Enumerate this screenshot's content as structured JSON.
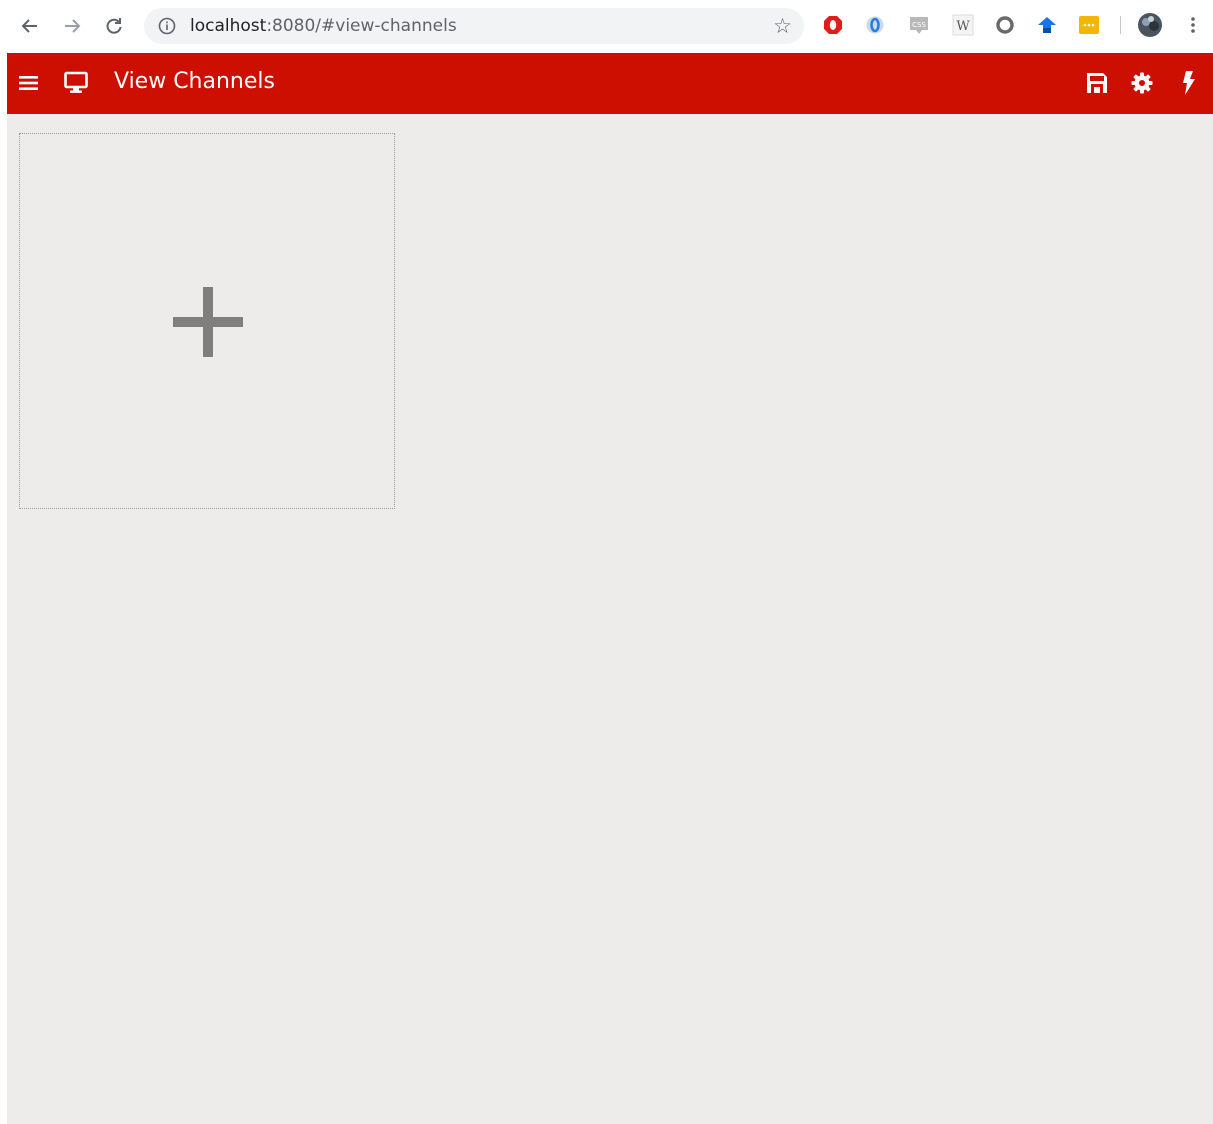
{
  "browser": {
    "url_host": "localhost",
    "url_rest": ":8080/#view-channels",
    "icons": {
      "back": "arrow-left-icon",
      "forward": "arrow-right-icon",
      "reload": "reload-icon",
      "info": "info-icon",
      "bookmark": "star-icon"
    },
    "extensions": [
      {
        "name": "adblock-extension-icon",
        "color": "#e21b1b"
      },
      {
        "name": "opera-extension-icon",
        "color": "#2a7fd4"
      },
      {
        "name": "css-extension-icon",
        "color": "#8a8a8a"
      },
      {
        "name": "wikipedia-extension-icon",
        "color": "#555555"
      },
      {
        "name": "ring-extension-icon",
        "color": "#6a6a6a"
      },
      {
        "name": "arrow-up-extension-icon",
        "color": "#1a73e8"
      },
      {
        "name": "more-extension-icon",
        "color": "#f2b705"
      },
      {
        "name": "profile-avatar",
        "color": "#4a5560"
      }
    ]
  },
  "app_bar": {
    "title": "View Channels",
    "background": "#cc0f00",
    "icons": {
      "menu": "menu-icon",
      "monitor": "monitor-icon",
      "save": "save-icon",
      "settings": "gear-icon",
      "flash": "lightning-icon"
    }
  },
  "content": {
    "background": "#edecea",
    "add_tile": {
      "icon": "plus-icon",
      "icon_color": "#7f7f7f"
    }
  }
}
